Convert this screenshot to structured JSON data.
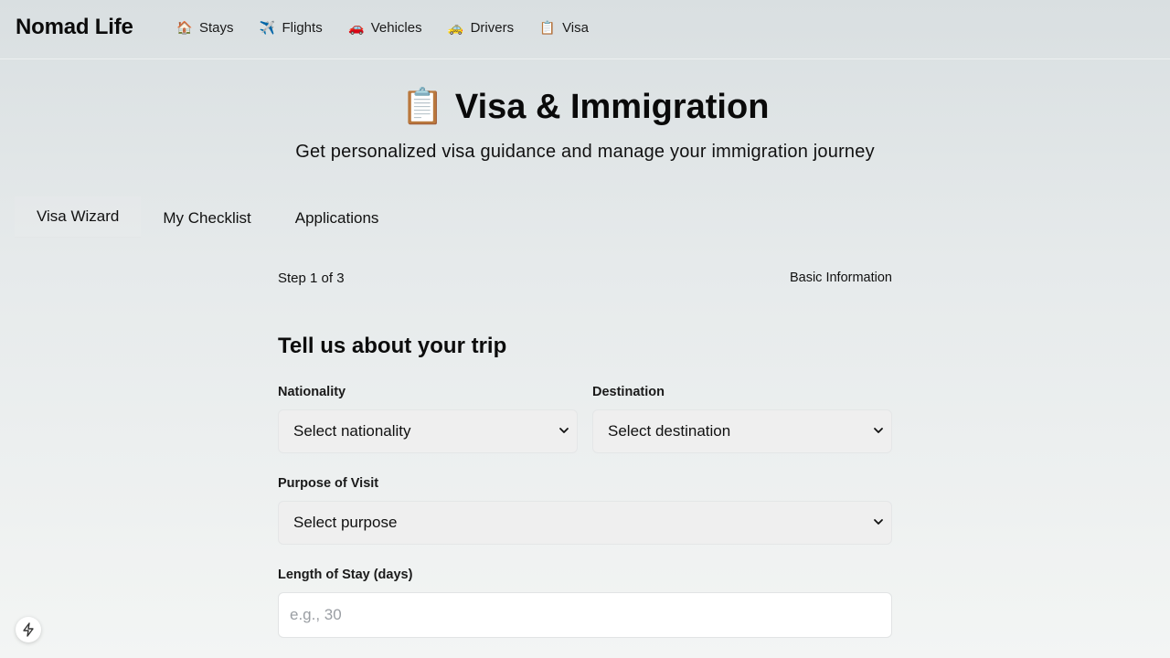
{
  "brand": "Nomad Life",
  "nav": [
    {
      "label": "Stays",
      "icon": "🏠",
      "icon_name": "house-icon"
    },
    {
      "label": "Flights",
      "icon": "✈️",
      "icon_name": "airplane-icon"
    },
    {
      "label": "Vehicles",
      "icon": "🚗",
      "icon_name": "car-icon"
    },
    {
      "label": "Drivers",
      "icon": "🚕",
      "icon_name": "taxi-icon"
    },
    {
      "label": "Visa",
      "icon": "📋",
      "icon_name": "clipboard-icon"
    }
  ],
  "hero": {
    "icon": "📋",
    "title": "Visa & Immigration",
    "subtitle": "Get personalized visa guidance and manage your immigration journey"
  },
  "tabs": [
    {
      "label": "Visa Wizard",
      "active": true
    },
    {
      "label": "My Checklist",
      "active": false
    },
    {
      "label": "Applications",
      "active": false
    }
  ],
  "wizard": {
    "step_text": "Step 1 of 3",
    "step_name": "Basic Information",
    "form_title": "Tell us about your trip",
    "nationality": {
      "label": "Nationality",
      "value": "Select nationality"
    },
    "destination": {
      "label": "Destination",
      "value": "Select destination"
    },
    "purpose": {
      "label": "Purpose of Visit",
      "value": "Select purpose"
    },
    "length": {
      "label": "Length of Stay (days)",
      "placeholder": "e.g., 30"
    }
  },
  "colors": {
    "bg_top": "#d9dfe1",
    "bg_bottom": "#f3f5f4",
    "select_bg": "#efefef",
    "input_bg": "#ffffff"
  }
}
